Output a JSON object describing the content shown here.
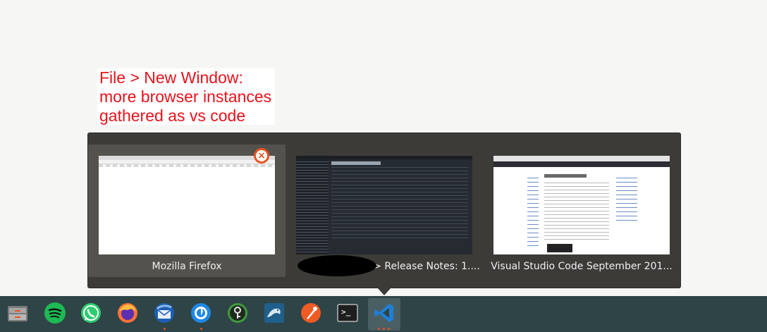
{
  "annotation": {
    "lines": [
      "File > New Window:",
      "more browser instances",
      "gathered as vs code"
    ]
  },
  "switcher": {
    "windows": [
      {
        "title": "Mozilla Firefox",
        "selected": true,
        "close_glyph": "×"
      },
      {
        "title": "> Release Notes: 1....",
        "selected": false
      },
      {
        "title": "Visual Studio Code September 201...",
        "selected": false
      }
    ]
  },
  "dock": {
    "items": [
      {
        "name": "files-icon"
      },
      {
        "name": "spotify-icon"
      },
      {
        "name": "whatsapp-icon"
      },
      {
        "name": "firefox-icon"
      },
      {
        "name": "thunderbird-icon"
      },
      {
        "name": "mattermost-icon"
      },
      {
        "name": "keepassxc-icon"
      },
      {
        "name": "mysql-workbench-icon"
      },
      {
        "name": "postman-icon"
      },
      {
        "name": "terminal-icon",
        "label": ">_"
      },
      {
        "name": "vscode-icon",
        "active": true
      }
    ]
  },
  "colors": {
    "accent": "#e95420",
    "annotation_text": "#e8121b",
    "dock_bg": "#2f4446",
    "switcher_bg": "#3c3b37"
  }
}
